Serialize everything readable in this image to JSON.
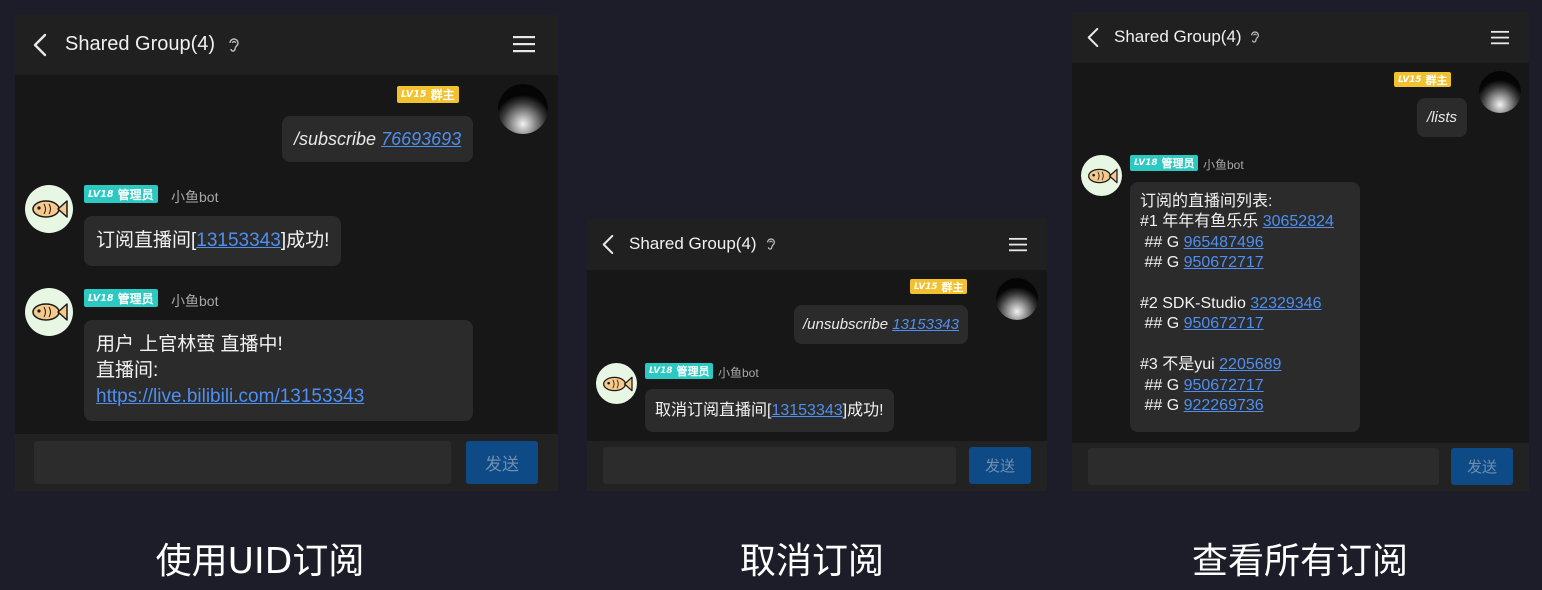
{
  "header": {
    "title": "Shared Group(4)"
  },
  "badges": {
    "owner_level": "LV15",
    "owner_role": "群主",
    "admin_level": "LV18",
    "admin_role": "管理员"
  },
  "bot": {
    "name": "小鱼bot"
  },
  "send_label": "发送",
  "panel1": {
    "command": "/subscribe",
    "command_arg": "76693693",
    "reply1_prefix": "订阅直播间[",
    "reply1_id": "13153343",
    "reply1_suffix": "]成功!",
    "reply2_line1": "用户 上官林萤 直播中!",
    "reply2_line2": "直播间:",
    "reply2_link": "https://live.bilibili.com/13153343",
    "caption": "使用UID订阅"
  },
  "panel2": {
    "command": "/unsubscribe",
    "command_arg": "13153343",
    "reply_prefix": "取消订阅直播间[",
    "reply_id": "13153343",
    "reply_suffix": "]成功!",
    "caption": "取消订阅"
  },
  "panel3": {
    "command": "/lists",
    "list_title": "订阅的直播间列表:",
    "rooms": [
      {
        "label": "#1 年年有鱼乐乐 ",
        "id": "30652824",
        "groups": [
          "965487496",
          "950672717"
        ]
      },
      {
        "label": "#2 SDK-Studio ",
        "id": "32329346",
        "groups": [
          "950672717"
        ]
      },
      {
        "label": "#3 不是yui ",
        "id": "2205689",
        "groups": [
          "950672717",
          "922269736"
        ]
      }
    ],
    "group_prefix": " ## G ",
    "caption": "查看所有订阅"
  },
  "colors": {
    "owner_badge": "#f2c12e",
    "admin_badge": "#2bc9c1",
    "link": "#4f8ff0",
    "send_button": "#0e4a85"
  }
}
